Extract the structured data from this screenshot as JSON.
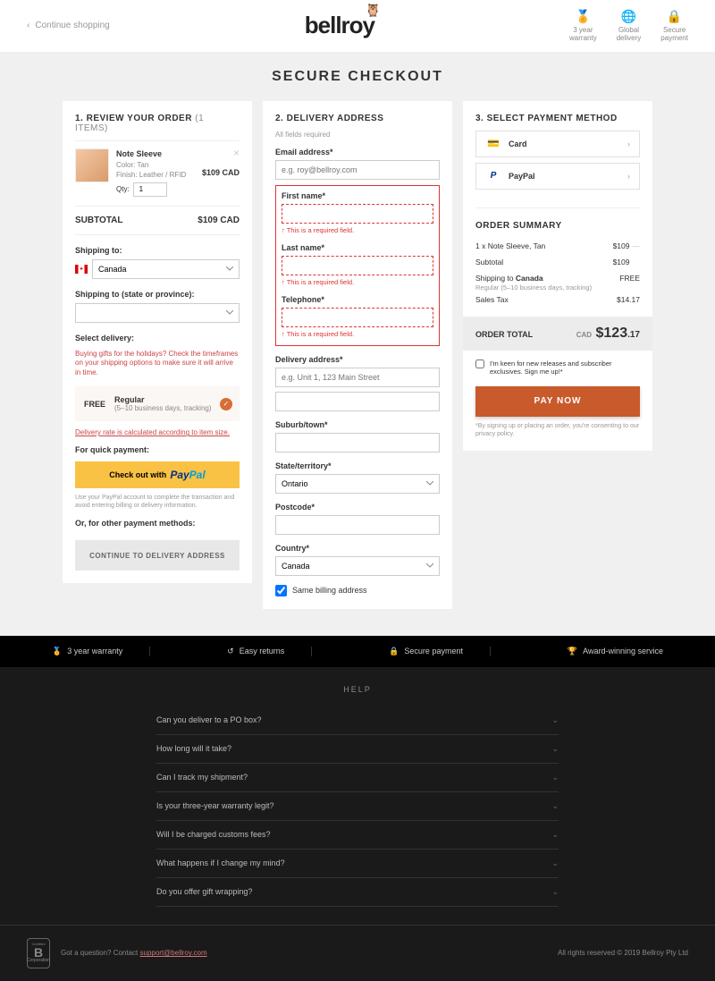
{
  "header": {
    "continue": "Continue shopping",
    "logo": "bellroy",
    "badges": [
      {
        "icon": "🏅",
        "line1": "3 year",
        "line2": "warranty"
      },
      {
        "icon": "🌐",
        "line1": "Global",
        "line2": "delivery"
      },
      {
        "icon": "🔒",
        "line1": "Secure",
        "line2": "payment"
      }
    ]
  },
  "pageTitle": "SECURE CHECKOUT",
  "review": {
    "title": "1. REVIEW YOUR ORDER",
    "count": "(1 ITEMS)",
    "item": {
      "name": "Note Sleeve",
      "color": "Color: Tan",
      "finish": "Finish: Leather / RFID",
      "qtyLabel": "Qty:",
      "qty": "1",
      "price": "$109 CAD"
    },
    "subtotalLabel": "SUBTOTAL",
    "subtotal": "$109 CAD",
    "shipToLabel": "Shipping to:",
    "country": "Canada",
    "shipStateLabel": "Shipping to (state or province):",
    "state": "",
    "selectDeliveryLabel": "Select delivery:",
    "holidayNotice": "Buying gifts for the holidays? Check the timeframes on your shipping options to make sure it will arrive in time.",
    "deliveryOpt": {
      "free": "FREE",
      "name": "Regular",
      "desc": "(5–10 business days, tracking)"
    },
    "rateLink": "Delivery rate is calculated according to item size.",
    "quickPayLabel": "For quick payment:",
    "paypalBtn": "Check out with",
    "paypalDisclaimer": "Use your PayPal account to complete the transaction and avoid entering billing or delivery information.",
    "orOther": "Or, for other payment methods:",
    "continueBtn": "CONTINUE TO DELIVERY ADDRESS"
  },
  "delivery": {
    "title": "2. DELIVERY ADDRESS",
    "allFields": "All fields required",
    "emailLabel": "Email address*",
    "emailPlaceholder": "e.g. roy@bellroy.com",
    "firstNameLabel": "First name*",
    "lastNameLabel": "Last name*",
    "telephoneLabel": "Telephone*",
    "requiredMsg": "↑ This is a required field.",
    "addressLabel": "Delivery address*",
    "addressPlaceholder": "e.g. Unit 1, 123 Main Street",
    "suburbLabel": "Suburb/town*",
    "stateLabel": "State/territory*",
    "stateValue": "Ontario",
    "postcodeLabel": "Postcode*",
    "countryLabel": "Country*",
    "countryValue": "Canada",
    "sameBilling": "Same billing address"
  },
  "payment": {
    "title": "3. SELECT PAYMENT METHOD",
    "card": "Card",
    "paypal": "PayPal",
    "summaryTitle": "ORDER SUMMARY",
    "lines": {
      "item": {
        "label": "1 x Note Sleeve, Tan",
        "val": "$109"
      },
      "subtotal": {
        "label": "Subtotal",
        "val": "$109"
      },
      "shipping": {
        "label": "Shipping to ",
        "country": "Canada",
        "val": "FREE",
        "sub": "Regular (5–10 business days, tracking)"
      },
      "tax": {
        "label": "Sales Tax",
        "val": "$14.17"
      }
    },
    "totalLabel": "ORDER TOTAL",
    "totalCur": "CAD",
    "totalMain": "$123",
    "totalCents": ".17",
    "optIn": "I'm keen for new releases and subscriber exclusives. Sign me up!*",
    "payNow": "PAY NOW",
    "consent": "*By signing up or placing an order, you're consenting to our privacy policy."
  },
  "footerStrip": [
    {
      "icon": "🏅",
      "text": "3 year warranty"
    },
    {
      "icon": "↺",
      "text": "Easy returns"
    },
    {
      "icon": "🔒",
      "text": "Secure payment"
    },
    {
      "icon": "🏆",
      "text": "Award-winning service"
    }
  ],
  "help": {
    "title": "HELP",
    "faqs": [
      "Can you deliver to a PO box?",
      "How long will it take?",
      "Can I track my shipment?",
      "Is your three-year warranty legit?",
      "Will I be charged customs fees?",
      "What happens if I change my mind?",
      "Do you offer gift wrapping?"
    ]
  },
  "footerBottom": {
    "question": "Got a question? Contact ",
    "email": "support@bellroy.com",
    "rights": "All rights reserved © 2019 Bellroy Pty Ltd"
  }
}
